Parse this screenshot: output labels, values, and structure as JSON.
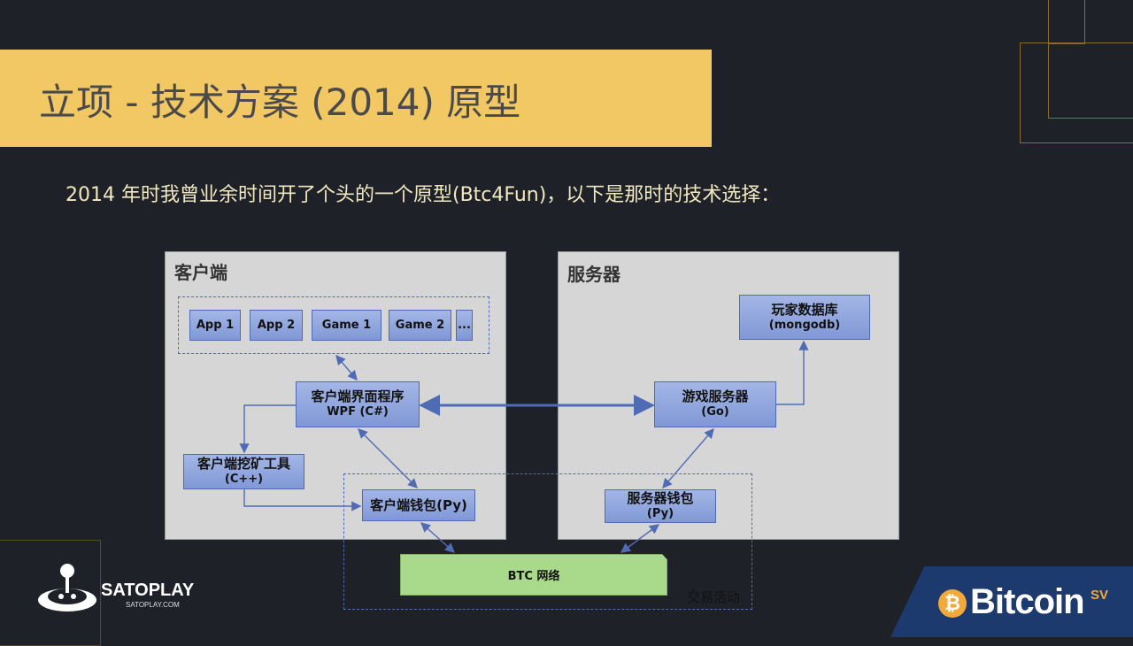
{
  "title": "立项 - 技术方案 (2014) 原型",
  "subtitle": "2014 年时我曾业余时间开了个头的一个原型(Btc4Fun)，以下是那时的技术选择：",
  "client": {
    "label": "客户端",
    "apps": [
      "App 1",
      "App 2",
      "Game 1",
      "Game 2",
      "..."
    ],
    "ui": {
      "line1": "客户端界面程序",
      "line2": "WPF (C#)"
    },
    "miner": {
      "line1": "客户端挖矿工具",
      "line2": "(C++)"
    },
    "wallet": {
      "line1": "客户端钱包(Py)"
    }
  },
  "server": {
    "label": "服务器",
    "db": {
      "line1": "玩家数据库",
      "line2": "(mongodb)"
    },
    "game": {
      "line1": "游戏服务器",
      "line2": "(Go)"
    },
    "wallet": {
      "line1": "服务器钱包",
      "line2": "(Py)"
    }
  },
  "network": {
    "label": "BTC 网络"
  },
  "transaction_label": "交易活动",
  "logos": {
    "satoplay_name": "SATOPLAY",
    "satoplay_url": "SATOPLAY.COM",
    "bitcoin": "Bitcoin",
    "bitcoin_sv": "SV"
  },
  "colors": {
    "background": "#1e2228",
    "title_bar": "#f2c864",
    "node_fill": "#8fa6de",
    "arrow": "#4f6bb4",
    "network_fill": "#a9d98b"
  }
}
